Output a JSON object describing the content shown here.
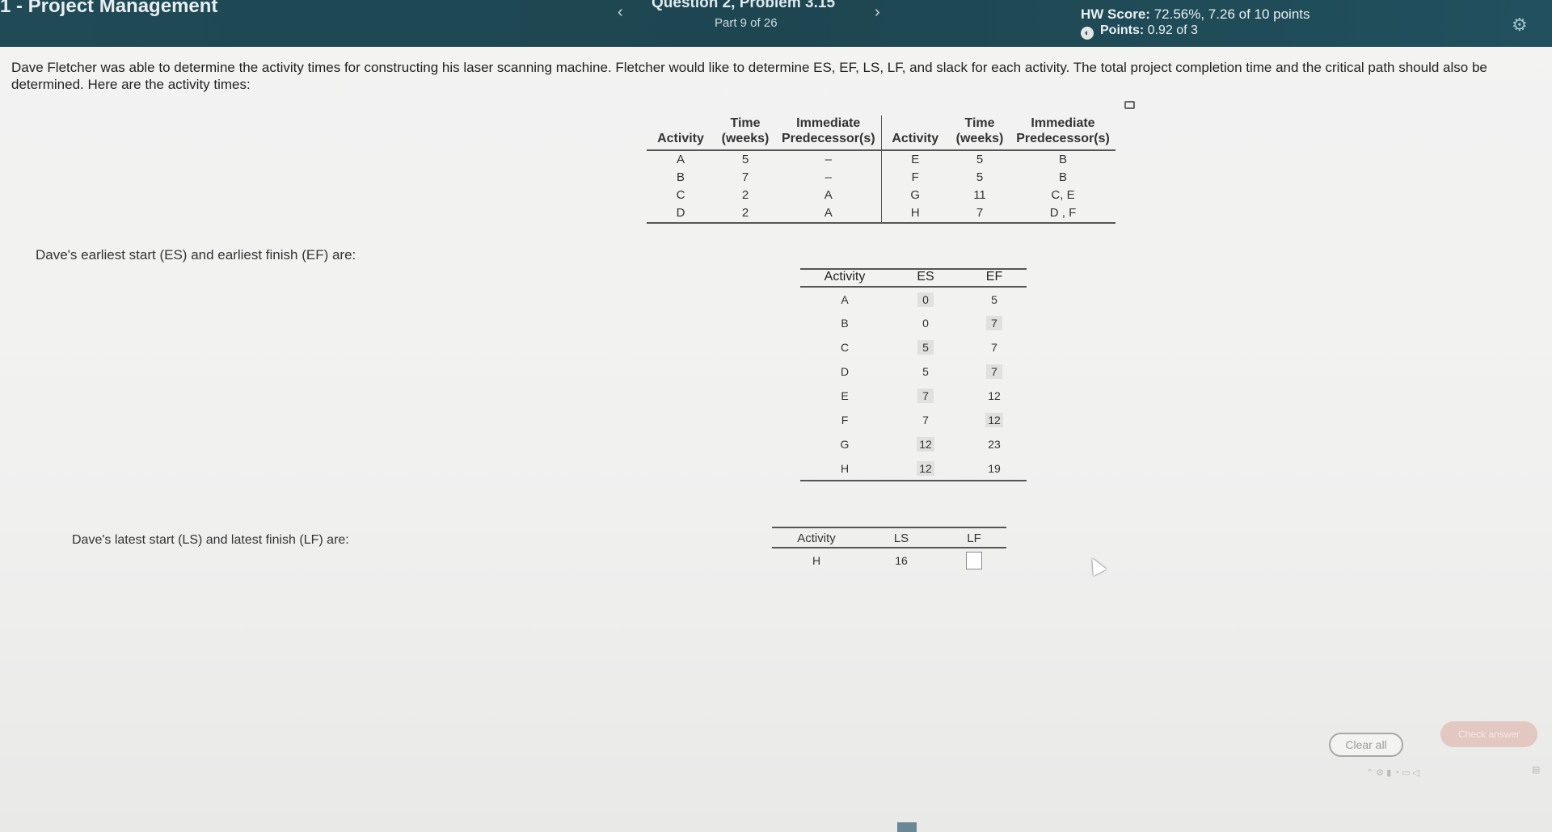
{
  "header": {
    "course_title": "1 - Project Management",
    "prev_label": "‹",
    "next_label": "›",
    "question_title": "Question 2, Problem 3.15",
    "part": "Part 9 of 26",
    "hw_score_label": "HW Score:",
    "hw_score_value": "72.56%, 7.26 of 10 points",
    "points_label": "Points:",
    "points_value": "0.92 of 3"
  },
  "question_text": "Dave Fletcher was able to determine the activity times for constructing his laser scanning machine. Fletcher would like to determine ES, EF, LS, LF, and slack for each activity. The total project completion time and the critical path should also be determined. Here are the activity times:",
  "activity_table": {
    "headers": {
      "activity": "Activity",
      "time_top": "Time",
      "time_bottom": "(weeks)",
      "pred_top": "Immediate",
      "pred_bottom": "Predecessor(s)"
    },
    "rows": [
      {
        "a1": "A",
        "t1": "5",
        "p1": "–",
        "a2": "E",
        "t2": "5",
        "p2": "B"
      },
      {
        "a1": "B",
        "t1": "7",
        "p1": "–",
        "a2": "F",
        "t2": "5",
        "p2": "B"
      },
      {
        "a1": "C",
        "t1": "2",
        "p1": "A",
        "a2": "G",
        "t2": "11",
        "p2": "C, E"
      },
      {
        "a1": "D",
        "t1": "2",
        "p1": "A",
        "a2": "H",
        "t2": "7",
        "p2": "D , F"
      }
    ]
  },
  "es_ef": {
    "label": "Dave's earliest start (ES) and earliest finish (EF) are:",
    "headers": {
      "activity": "Activity",
      "es": "ES",
      "ef": "EF"
    },
    "rows": [
      {
        "activity": "A",
        "es": "0",
        "ef": "5"
      },
      {
        "activity": "B",
        "es": "0",
        "ef": "7"
      },
      {
        "activity": "C",
        "es": "5",
        "ef": "7"
      },
      {
        "activity": "D",
        "es": "5",
        "ef": "7"
      },
      {
        "activity": "E",
        "es": "7",
        "ef": "12"
      },
      {
        "activity": "F",
        "es": "7",
        "ef": "12"
      },
      {
        "activity": "G",
        "es": "12",
        "ef": "23"
      },
      {
        "activity": "H",
        "es": "12",
        "ef": "19"
      }
    ]
  },
  "ls_lf": {
    "label": "Dave's latest start (LS) and latest finish (LF) are:",
    "headers": {
      "activity": "Activity",
      "ls": "LS",
      "lf": "LF"
    },
    "row": {
      "activity": "H",
      "ls": "16",
      "lf": ""
    }
  },
  "footer": {
    "clear_all": "Clear all",
    "check_answer": "Check answer"
  }
}
